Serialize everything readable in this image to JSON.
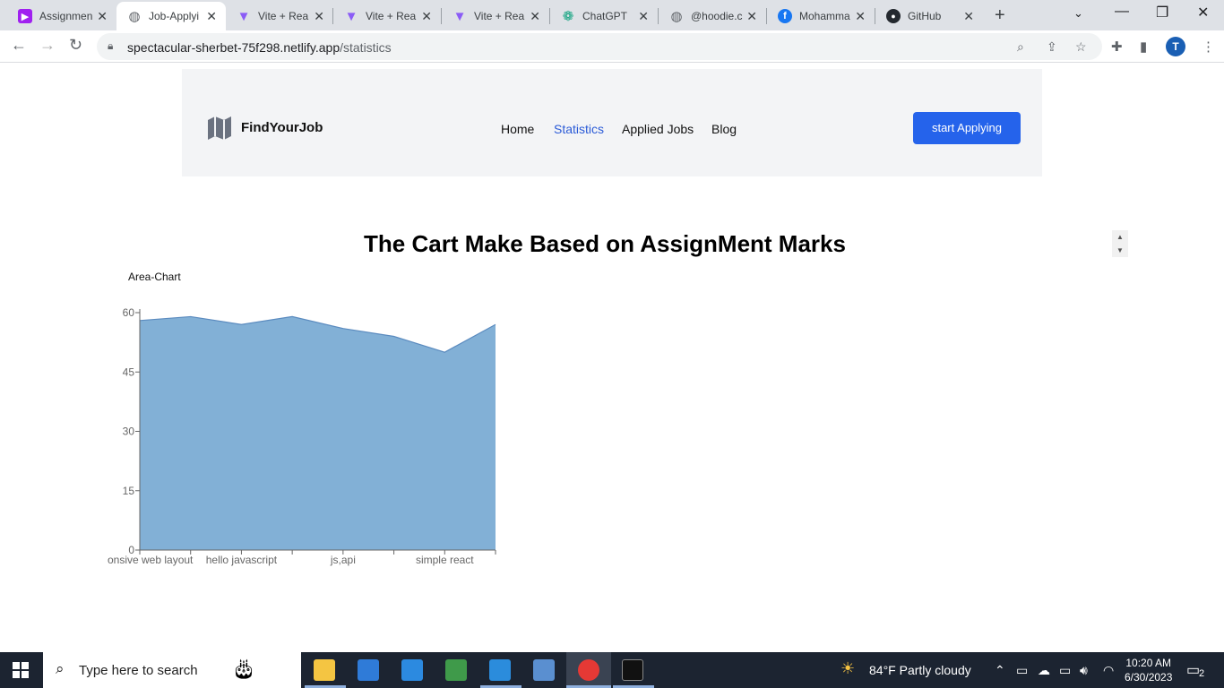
{
  "browser": {
    "tabs": [
      {
        "title": "Assignmen",
        "icon": "purple-play-icon",
        "color": "#a020f0"
      },
      {
        "title": "Job-Applyi",
        "icon": "globe-icon",
        "color": "#5f6368"
      },
      {
        "title": "Vite + Rea",
        "icon": "vite-icon",
        "color": "#8b5cf6"
      },
      {
        "title": "Vite + Rea",
        "icon": "vite-icon",
        "color": "#8b5cf6"
      },
      {
        "title": "Vite + Rea",
        "icon": "vite-icon",
        "color": "#8b5cf6"
      },
      {
        "title": "ChatGPT",
        "icon": "chatgpt-icon",
        "color": "#10a37f"
      },
      {
        "title": "@hoodie.c",
        "icon": "globe-icon",
        "color": "#5f6368"
      },
      {
        "title": "Mohamma",
        "icon": "facebook-icon",
        "color": "#1877f2"
      },
      {
        "title": "GitHub",
        "icon": "github-icon",
        "color": "#24292f"
      }
    ],
    "url_host": "spectacular-sherbet-75f298.netlify.app",
    "url_path": "/statistics",
    "profile_initial": "T"
  },
  "nav": {
    "brand": "FindYourJob",
    "links": [
      "Home",
      "Statistics",
      "Applied Jobs",
      "Blog"
    ],
    "cta": "start Applying",
    "accent": "#2563eb"
  },
  "page": {
    "heading": "The Cart Make Based on AssignMent Marks",
    "chart_label": "Area-Chart"
  },
  "chart_data": {
    "type": "area",
    "categories": [
      "responsive web layout",
      "",
      "hello javascript",
      "",
      "js,api",
      "",
      "simple react",
      ""
    ],
    "x_tick_labels": [
      "responsive web layout",
      "hello javascript",
      "js,api",
      "simple react"
    ],
    "values": [
      58,
      59,
      57,
      59,
      56,
      54,
      50,
      57
    ],
    "ylim": [
      0,
      60
    ],
    "yticks": [
      0,
      15,
      30,
      45,
      60
    ],
    "fill": "#82b0d6",
    "stroke": "#5b8bbf"
  },
  "taskbar": {
    "search_placeholder": "Type here to search",
    "weather": "84°F  Partly cloudy",
    "time": "10:20 AM",
    "date": "6/30/2023",
    "notification_count": "2"
  }
}
